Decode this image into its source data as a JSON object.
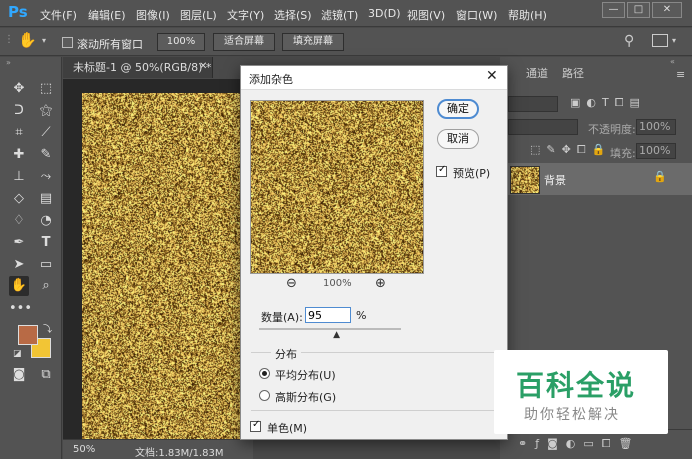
{
  "app": {
    "logo": "Ps",
    "menu": [
      "文件(F)",
      "编辑(E)",
      "图像(I)",
      "图层(L)",
      "文字(Y)",
      "选择(S)",
      "滤镜(T)",
      "3D(D)",
      "视图(V)",
      "窗口(W)",
      "帮助(H)"
    ]
  },
  "options": {
    "scroll_all_label": "滚动所有窗口",
    "zoom_100": "100%",
    "fit_screen": "适合屏幕",
    "fill_screen": "填充屏幕"
  },
  "document": {
    "tab_title": "未标题-1 @ 50%(RGB/8) *",
    "zoom": "50%",
    "file_info": "文档:1.83M/1.83M"
  },
  "panels": {
    "tabs": [
      "通道",
      "路径"
    ],
    "opacity_label": "不透明度:",
    "opacity_value": "100%",
    "fill_label": "填充:",
    "fill_value": "100%",
    "layer_name": "背景"
  },
  "dialog": {
    "title": "添加杂色",
    "ok": "确定",
    "cancel": "取消",
    "preview_label": "预览(P)",
    "preview_checked": true,
    "zoom": "100%",
    "amount_label": "数量(A):",
    "amount_value": "95",
    "amount_unit": "%",
    "amount_slider_fraction": 0.55,
    "distribution_label": "分布",
    "uniform_label": "平均分布(U)",
    "gaussian_label": "高斯分布(G)",
    "selected_distribution": "uniform",
    "mono_label": "单色(M)",
    "mono_checked": true
  },
  "watermark": {
    "title": "百科全说",
    "subtitle": "助你轻松解决"
  },
  "colors": {
    "foreground": "#b86a45",
    "background": "#f2c535",
    "noise_base": "#b8903e"
  }
}
